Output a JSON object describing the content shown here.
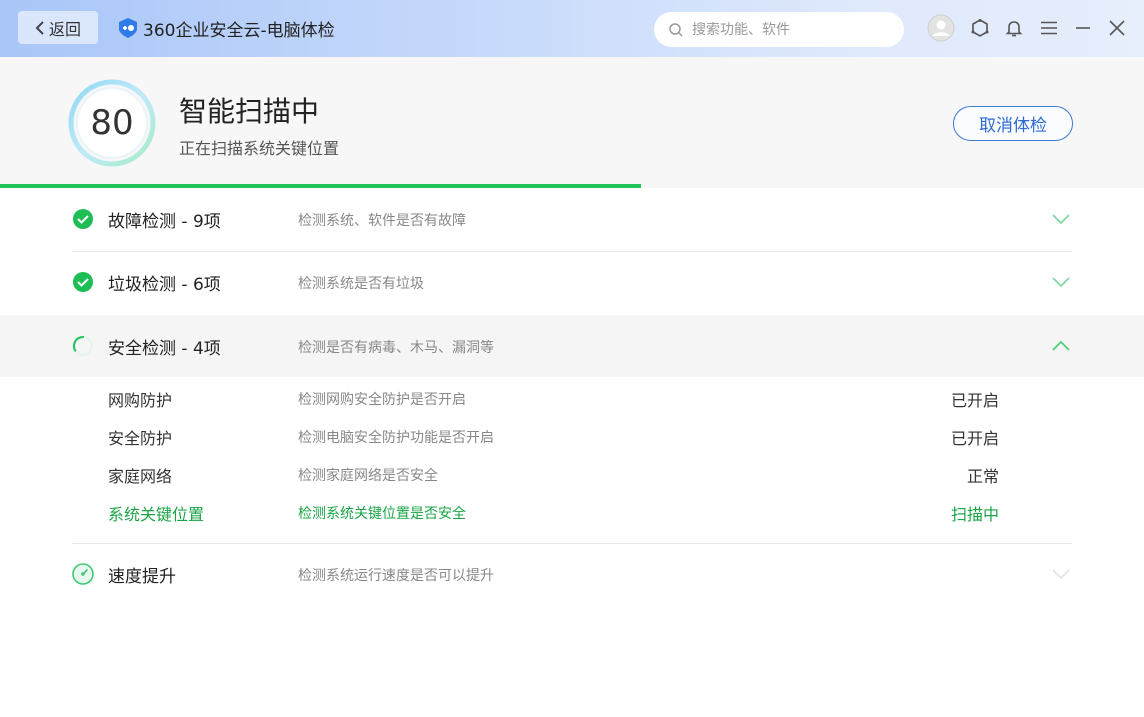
{
  "titlebar": {
    "back_label": "返回",
    "app_title": "360企业安全云-电脑体检",
    "search_placeholder": "搜索功能、软件"
  },
  "header": {
    "score": "80",
    "title": "智能扫描中",
    "subtitle": "正在扫描系统关键位置",
    "cancel_label": "取消体检",
    "progress": 0.56
  },
  "colors": {
    "accent": "#21c45a",
    "blue": "#2b6cd4"
  },
  "sections": [
    {
      "title": "故障检测 - 9项",
      "desc": "检测系统、软件是否有故障",
      "status": "done"
    },
    {
      "title": "垃圾检测 - 6项",
      "desc": "检测系统是否有垃圾",
      "status": "done"
    },
    {
      "title": "安全检测 - 4项",
      "desc": "检测是否有病毒、木马、漏洞等",
      "status": "scanning"
    },
    {
      "title": "速度提升",
      "desc": "检测系统运行速度是否可以提升",
      "status": "pending"
    }
  ],
  "security_items": [
    {
      "name": "网购防护",
      "desc": "检测网购安全防护是否开启",
      "state": "已开启"
    },
    {
      "name": "安全防护",
      "desc": "检测电脑安全防护功能是否开启",
      "state": "已开启"
    },
    {
      "name": "家庭网络",
      "desc": "检测家庭网络是否安全",
      "state": "正常"
    },
    {
      "name": "系统关键位置",
      "desc": "检测系统关键位置是否安全",
      "state": "扫描中"
    }
  ]
}
